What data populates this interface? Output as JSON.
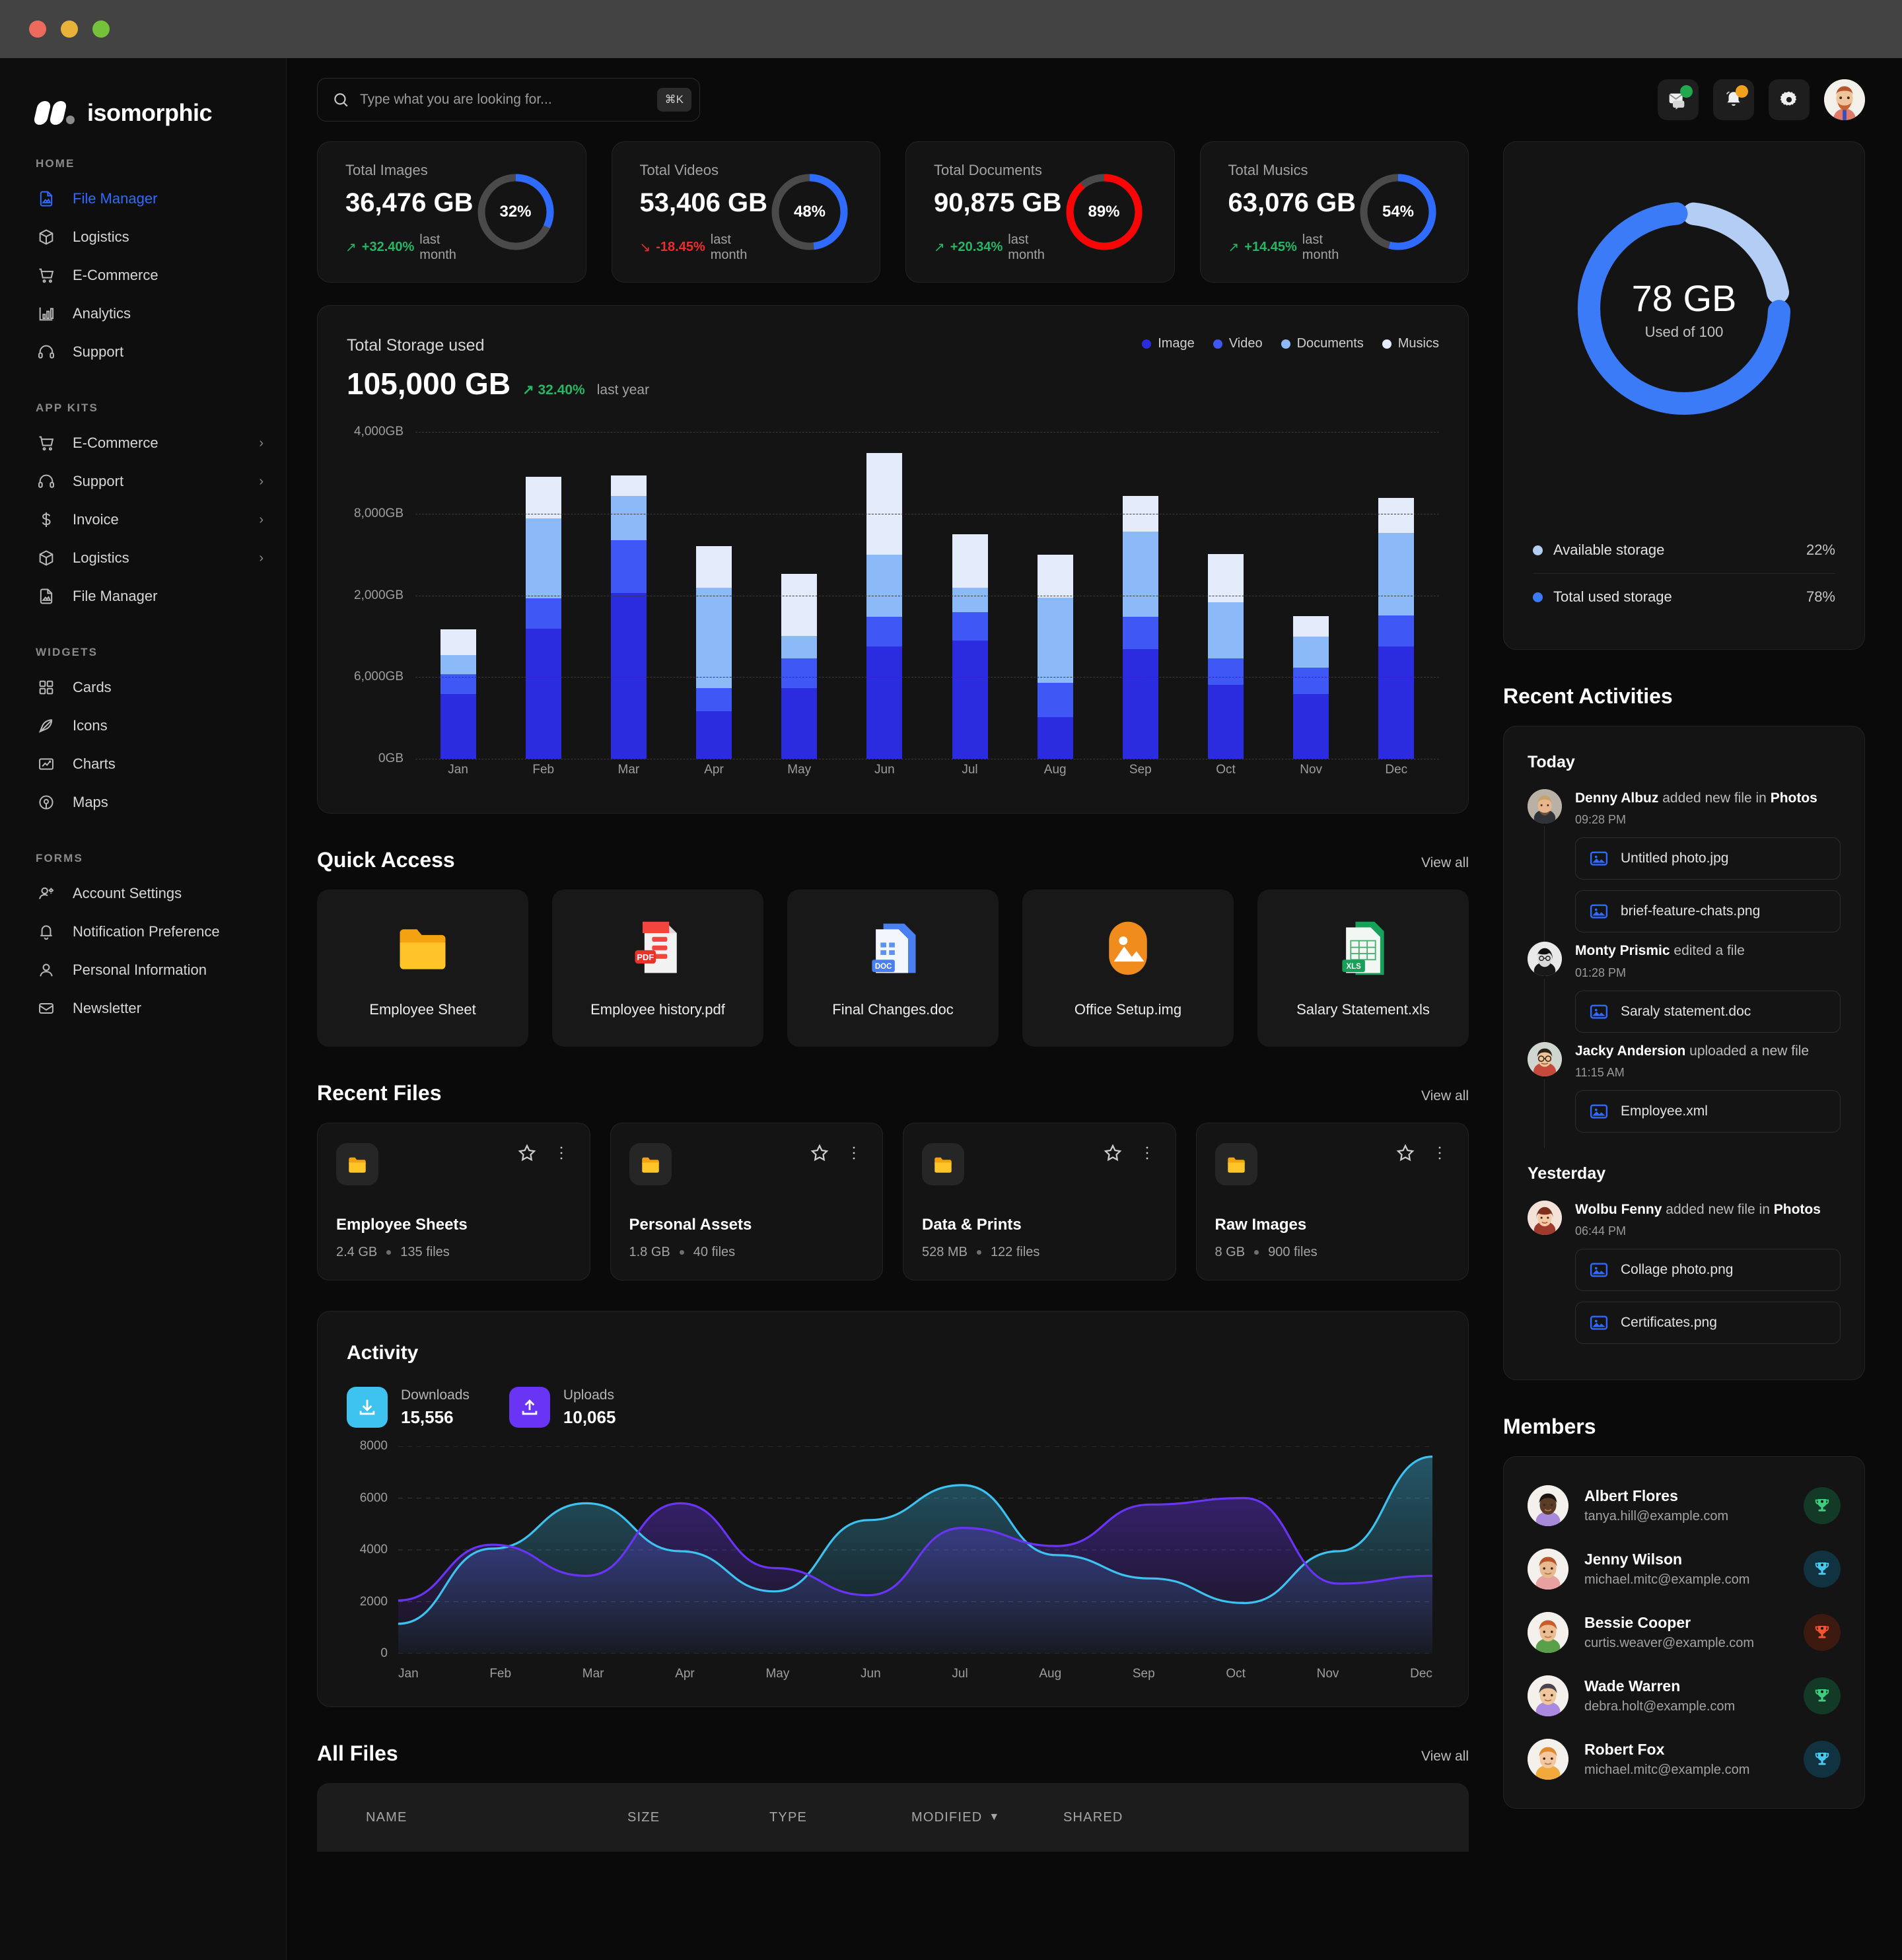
{
  "window": {
    "controls": [
      "close",
      "minimize",
      "maximize"
    ]
  },
  "brand": {
    "name": "isomorphic"
  },
  "search": {
    "placeholder": "Type what you are looking for...",
    "shortcut": "⌘K"
  },
  "topbar": {
    "mail_badge_color": "#22a94d",
    "bell_badge_color": "#f0a21c"
  },
  "sidebar": {
    "sections": [
      {
        "title": "HOME",
        "items": [
          {
            "label": "File Manager",
            "icon": "file-image-icon",
            "active": true,
            "chevron": false
          },
          {
            "label": "Logistics",
            "icon": "box-icon",
            "active": false,
            "chevron": false
          },
          {
            "label": "E-Commerce",
            "icon": "cart-icon",
            "active": false,
            "chevron": false
          },
          {
            "label": "Analytics",
            "icon": "bar-chart-icon",
            "active": false,
            "chevron": false
          },
          {
            "label": "Support",
            "icon": "headset-icon",
            "active": false,
            "chevron": false
          }
        ]
      },
      {
        "title": "APP KITS",
        "items": [
          {
            "label": "E-Commerce",
            "icon": "cart-icon",
            "active": false,
            "chevron": true
          },
          {
            "label": "Support",
            "icon": "headset-icon",
            "active": false,
            "chevron": true
          },
          {
            "label": "Invoice",
            "icon": "dollar-icon",
            "active": false,
            "chevron": true
          },
          {
            "label": "Logistics",
            "icon": "box-icon",
            "active": false,
            "chevron": true
          },
          {
            "label": "File Manager",
            "icon": "file-image-icon",
            "active": false,
            "chevron": false
          }
        ]
      },
      {
        "title": "WIDGETS",
        "items": [
          {
            "label": "Cards",
            "icon": "grid-icon",
            "active": false,
            "chevron": false
          },
          {
            "label": "Icons",
            "icon": "feather-icon",
            "active": false,
            "chevron": false
          },
          {
            "label": "Charts",
            "icon": "line-chart-icon",
            "active": false,
            "chevron": false
          },
          {
            "label": "Maps",
            "icon": "map-pin-icon",
            "active": false,
            "chevron": false
          }
        ]
      },
      {
        "title": "FORMS",
        "items": [
          {
            "label": "Account Settings",
            "icon": "user-gear-icon",
            "active": false,
            "chevron": false
          },
          {
            "label": "Notification Preference",
            "icon": "bell-icon",
            "active": false,
            "chevron": false
          },
          {
            "label": "Personal Information",
            "icon": "user-icon",
            "active": false,
            "chevron": false
          },
          {
            "label": "Newsletter",
            "icon": "envelope-icon",
            "active": false,
            "chevron": false
          }
        ]
      }
    ]
  },
  "stats": [
    {
      "label": "Total Images",
      "value": "36,476 GB",
      "delta": "+32.40%",
      "delta_dir": "up",
      "period": "last month",
      "percent": 32,
      "percent_label": "32%",
      "ring_color": "#2f6bff"
    },
    {
      "label": "Total Videos",
      "value": "53,406 GB",
      "delta": "-18.45%",
      "delta_dir": "down",
      "period": "last month",
      "percent": 48,
      "percent_label": "48%",
      "ring_color": "#2f6bff"
    },
    {
      "label": "Total Documents",
      "value": "90,875 GB",
      "delta": "+20.34%",
      "delta_dir": "up",
      "period": "last month",
      "percent": 89,
      "percent_label": "89%",
      "ring_color": "#fa0505"
    },
    {
      "label": "Total Musics",
      "value": "63,076 GB",
      "delta": "+14.45%",
      "delta_dir": "up",
      "period": "last month",
      "percent": 54,
      "percent_label": "54%",
      "ring_color": "#2f6bff"
    }
  ],
  "storage": {
    "title": "Total Storage used",
    "total": "105,000 GB",
    "delta": "32.40%",
    "period": "last year"
  },
  "donut": {
    "value": "78 GB",
    "subtitle": "Used of 100",
    "rows": [
      {
        "label": "Available storage",
        "value": "22%",
        "color": "#b4cdf5"
      },
      {
        "label": "Total used storage",
        "value": "78%",
        "color": "#3b7bf7"
      }
    ]
  },
  "quick_access": {
    "title": "Quick Access",
    "view_all": "View all",
    "items": [
      {
        "name": "Employee Sheet",
        "icon": "folder-icon"
      },
      {
        "name": "Employee history.pdf",
        "icon": "pdf-icon"
      },
      {
        "name": "Final Changes.doc",
        "icon": "doc-icon"
      },
      {
        "name": "Office Setup.img",
        "icon": "img-icon"
      },
      {
        "name": "Salary Statement.xls",
        "icon": "xls-icon"
      }
    ]
  },
  "recent_files": {
    "title": "Recent Files",
    "view_all": "View all",
    "items": [
      {
        "name": "Employee Sheets",
        "size": "2.4 GB",
        "files": "135 files"
      },
      {
        "name": "Personal Assets",
        "size": "1.8 GB",
        "files": "40 files"
      },
      {
        "name": "Data & Prints",
        "size": "528 MB",
        "files": "122 files"
      },
      {
        "name": "Raw Images",
        "size": "8 GB",
        "files": "900 files"
      }
    ]
  },
  "activity": {
    "title": "Activity",
    "downloads_label": "Downloads",
    "downloads_value": "15,556",
    "uploads_label": "Uploads",
    "uploads_value": "10,065",
    "downloads_color": "#3ec2f0",
    "uploads_color": "#6a34f5"
  },
  "all_files": {
    "title": "All Files",
    "view_all": "View all",
    "columns": [
      "NAME",
      "SIZE",
      "TYPE",
      "MODIFIED",
      "SHARED"
    ],
    "sort_column": "MODIFIED",
    "sort_dir": "desc"
  },
  "recent_activities": {
    "title": "Recent Activities",
    "groups": [
      {
        "day": "Today",
        "items": [
          {
            "user": "Denny Albuz",
            "action": "added new file in",
            "target": "Photos",
            "time": "09:28 PM",
            "files": [
              "Untitled photo.jpg",
              "brief-feature-chats.png"
            ],
            "avatar": "male-blond"
          },
          {
            "user": "Monty Prismic",
            "action": "edited a file",
            "target": "",
            "time": "01:28 PM",
            "files": [
              "Saraly statement.doc"
            ],
            "avatar": "female-dark"
          },
          {
            "user": "Jacky Andersion",
            "action": "uploaded a new file",
            "target": "",
            "time": "11:15 AM",
            "files": [
              "Employee.xml"
            ],
            "avatar": "male-glasses"
          }
        ]
      },
      {
        "day": "Yesterday",
        "items": [
          {
            "user": "Wolbu Fenny",
            "action": "added new file in",
            "target": "Photos",
            "time": "06:44 PM",
            "files": [
              "Collage photo.png",
              "Certificates.png"
            ],
            "avatar": "female-red"
          }
        ]
      }
    ]
  },
  "members": {
    "title": "Members",
    "items": [
      {
        "name": "Albert Flores",
        "email": "tanya.hill@example.com",
        "badge_color": "#3ecf7e",
        "badge_bg": "#123a26",
        "avatar_bg": "#a78bda",
        "skin": "#5b3a26",
        "hair": "#1d1410"
      },
      {
        "name": "Jenny Wilson",
        "email": "michael.mitc@example.com",
        "badge_color": "#49c8f0",
        "badge_bg": "#113240",
        "avatar_bg": "#e8a0a0",
        "skin": "#e8b98f",
        "hair": "#b5562a"
      },
      {
        "name": "Bessie Cooper",
        "email": "curtis.weaver@example.com",
        "badge_color": "#f1542f",
        "badge_bg": "#3d1a10",
        "avatar_bg": "#5aa04a",
        "skin": "#edbd92",
        "hair": "#c85a2b"
      },
      {
        "name": "Wade Warren",
        "email": "debra.holt@example.com",
        "badge_color": "#3ecf7e",
        "badge_bg": "#123a26",
        "avatar_bg": "#a98ae0",
        "skin": "#f0c79c",
        "hair": "#4a4450"
      },
      {
        "name": "Robert Fox",
        "email": "michael.mitc@example.com",
        "badge_color": "#49c8f0",
        "badge_bg": "#113240",
        "avatar_bg": "#f2a93b",
        "skin": "#f4c79e",
        "hair": "#e08a2f"
      }
    ]
  },
  "chart_data": [
    {
      "type": "bar",
      "title": "Total Storage used",
      "stacked": true,
      "categories": [
        "Jan",
        "Feb",
        "Mar",
        "Apr",
        "May",
        "Jun",
        "Jul",
        "Aug",
        "Sep",
        "Oct",
        "Nov",
        "Dec"
      ],
      "series": [
        {
          "name": "Image",
          "color": "#2b2be0",
          "values": [
            1100,
            2200,
            2800,
            800,
            1200,
            1900,
            2000,
            700,
            1850,
            1250,
            1100,
            1900
          ]
        },
        {
          "name": "Video",
          "color": "#3f58f5",
          "values": [
            330,
            520,
            900,
            400,
            500,
            500,
            480,
            580,
            550,
            450,
            440,
            520
          ]
        },
        {
          "name": "Documents",
          "color": "#8cbaf8",
          "values": [
            330,
            1350,
            750,
            1700,
            380,
            1050,
            420,
            1450,
            1450,
            950,
            530,
            1400
          ]
        },
        {
          "name": "Musics",
          "color": "#e4ecfb",
          "values": [
            430,
            700,
            350,
            700,
            1050,
            1720,
            900,
            720,
            600,
            820,
            340,
            600
          ]
        }
      ],
      "ytick_labels": [
        "4,000GB",
        "8,000GB",
        "2,000GB",
        "6,000GB",
        "0GB"
      ],
      "xlabel": "",
      "ylabel": "",
      "grid": true,
      "legend_position": "top-right"
    },
    {
      "type": "pie",
      "title": "Storage usage",
      "labels": [
        "Total used storage",
        "Available storage"
      ],
      "values": [
        78,
        22
      ],
      "colors": [
        "#3b7bf7",
        "#b4cdf5"
      ],
      "center_label": "78 GB",
      "center_sublabel": "Used of 100"
    },
    {
      "type": "area",
      "title": "Activity",
      "x": [
        "Jan",
        "Feb",
        "Mar",
        "Apr",
        "May",
        "Jun",
        "Jul",
        "Aug",
        "Sep",
        "Oct",
        "Nov",
        "Dec"
      ],
      "series": [
        {
          "name": "Downloads",
          "color": "#3ec2f0",
          "values": [
            1150,
            4050,
            5800,
            3950,
            2400,
            5150,
            6500,
            3800,
            2900,
            1950,
            3950,
            7600
          ]
        },
        {
          "name": "Uploads",
          "color": "#6a34f5",
          "values": [
            2050,
            4200,
            3000,
            5800,
            3300,
            2250,
            4850,
            4150,
            5750,
            6000,
            2700,
            3000
          ]
        }
      ],
      "ylim": [
        0,
        8000
      ],
      "ytick_labels": [
        "0",
        "2000",
        "4000",
        "6000",
        "8000"
      ],
      "grid": true,
      "legend_position": "none"
    }
  ]
}
